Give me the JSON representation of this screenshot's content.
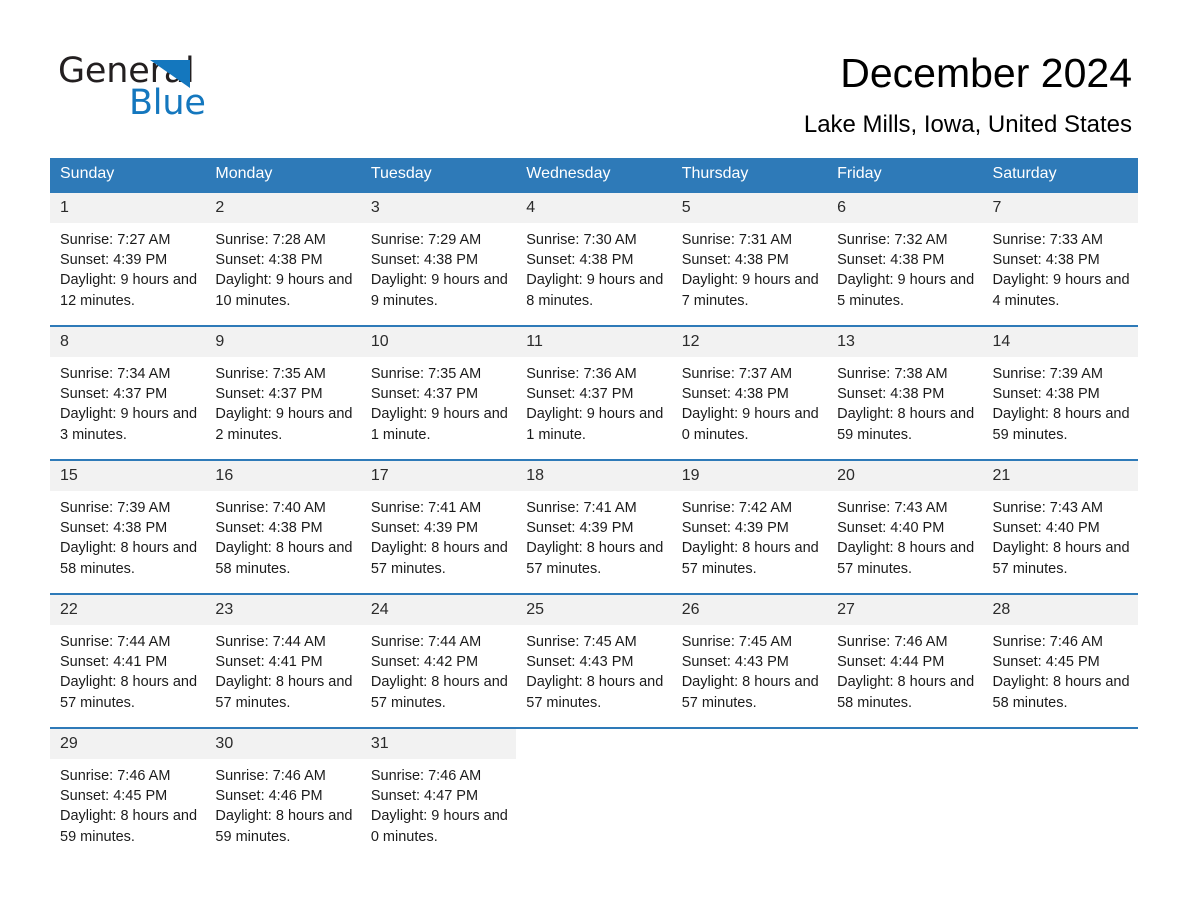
{
  "brand": {
    "word_one": "General",
    "word_two": "Blue",
    "triangle_color": "#1477be",
    "text_color": "#231f20"
  },
  "header": {
    "title": "December 2024",
    "location": "Lake Mills, Iowa, United States",
    "accent_color": "#2e7ab8",
    "daynum_band_color": "#f2f2f2"
  },
  "weekdays": [
    "Sunday",
    "Monday",
    "Tuesday",
    "Wednesday",
    "Thursday",
    "Friday",
    "Saturday"
  ],
  "labels": {
    "sunrise_prefix": "Sunrise: ",
    "sunset_prefix": "Sunset: ",
    "daylight_prefix": "Daylight: "
  },
  "weeks": [
    [
      {
        "day": "1",
        "sunrise": "Sunrise: 7:27 AM",
        "sunset": "Sunset: 4:39 PM",
        "daylight": "Daylight: 9 hours and 12 minutes."
      },
      {
        "day": "2",
        "sunrise": "Sunrise: 7:28 AM",
        "sunset": "Sunset: 4:38 PM",
        "daylight": "Daylight: 9 hours and 10 minutes."
      },
      {
        "day": "3",
        "sunrise": "Sunrise: 7:29 AM",
        "sunset": "Sunset: 4:38 PM",
        "daylight": "Daylight: 9 hours and 9 minutes."
      },
      {
        "day": "4",
        "sunrise": "Sunrise: 7:30 AM",
        "sunset": "Sunset: 4:38 PM",
        "daylight": "Daylight: 9 hours and 8 minutes."
      },
      {
        "day": "5",
        "sunrise": "Sunrise: 7:31 AM",
        "sunset": "Sunset: 4:38 PM",
        "daylight": "Daylight: 9 hours and 7 minutes."
      },
      {
        "day": "6",
        "sunrise": "Sunrise: 7:32 AM",
        "sunset": "Sunset: 4:38 PM",
        "daylight": "Daylight: 9 hours and 5 minutes."
      },
      {
        "day": "7",
        "sunrise": "Sunrise: 7:33 AM",
        "sunset": "Sunset: 4:38 PM",
        "daylight": "Daylight: 9 hours and 4 minutes."
      }
    ],
    [
      {
        "day": "8",
        "sunrise": "Sunrise: 7:34 AM",
        "sunset": "Sunset: 4:37 PM",
        "daylight": "Daylight: 9 hours and 3 minutes."
      },
      {
        "day": "9",
        "sunrise": "Sunrise: 7:35 AM",
        "sunset": "Sunset: 4:37 PM",
        "daylight": "Daylight: 9 hours and 2 minutes."
      },
      {
        "day": "10",
        "sunrise": "Sunrise: 7:35 AM",
        "sunset": "Sunset: 4:37 PM",
        "daylight": "Daylight: 9 hours and 1 minute."
      },
      {
        "day": "11",
        "sunrise": "Sunrise: 7:36 AM",
        "sunset": "Sunset: 4:37 PM",
        "daylight": "Daylight: 9 hours and 1 minute."
      },
      {
        "day": "12",
        "sunrise": "Sunrise: 7:37 AM",
        "sunset": "Sunset: 4:38 PM",
        "daylight": "Daylight: 9 hours and 0 minutes."
      },
      {
        "day": "13",
        "sunrise": "Sunrise: 7:38 AM",
        "sunset": "Sunset: 4:38 PM",
        "daylight": "Daylight: 8 hours and 59 minutes."
      },
      {
        "day": "14",
        "sunrise": "Sunrise: 7:39 AM",
        "sunset": "Sunset: 4:38 PM",
        "daylight": "Daylight: 8 hours and 59 minutes."
      }
    ],
    [
      {
        "day": "15",
        "sunrise": "Sunrise: 7:39 AM",
        "sunset": "Sunset: 4:38 PM",
        "daylight": "Daylight: 8 hours and 58 minutes."
      },
      {
        "day": "16",
        "sunrise": "Sunrise: 7:40 AM",
        "sunset": "Sunset: 4:38 PM",
        "daylight": "Daylight: 8 hours and 58 minutes."
      },
      {
        "day": "17",
        "sunrise": "Sunrise: 7:41 AM",
        "sunset": "Sunset: 4:39 PM",
        "daylight": "Daylight: 8 hours and 57 minutes."
      },
      {
        "day": "18",
        "sunrise": "Sunrise: 7:41 AM",
        "sunset": "Sunset: 4:39 PM",
        "daylight": "Daylight: 8 hours and 57 minutes."
      },
      {
        "day": "19",
        "sunrise": "Sunrise: 7:42 AM",
        "sunset": "Sunset: 4:39 PM",
        "daylight": "Daylight: 8 hours and 57 minutes."
      },
      {
        "day": "20",
        "sunrise": "Sunrise: 7:43 AM",
        "sunset": "Sunset: 4:40 PM",
        "daylight": "Daylight: 8 hours and 57 minutes."
      },
      {
        "day": "21",
        "sunrise": "Sunrise: 7:43 AM",
        "sunset": "Sunset: 4:40 PM",
        "daylight": "Daylight: 8 hours and 57 minutes."
      }
    ],
    [
      {
        "day": "22",
        "sunrise": "Sunrise: 7:44 AM",
        "sunset": "Sunset: 4:41 PM",
        "daylight": "Daylight: 8 hours and 57 minutes."
      },
      {
        "day": "23",
        "sunrise": "Sunrise: 7:44 AM",
        "sunset": "Sunset: 4:41 PM",
        "daylight": "Daylight: 8 hours and 57 minutes."
      },
      {
        "day": "24",
        "sunrise": "Sunrise: 7:44 AM",
        "sunset": "Sunset: 4:42 PM",
        "daylight": "Daylight: 8 hours and 57 minutes."
      },
      {
        "day": "25",
        "sunrise": "Sunrise: 7:45 AM",
        "sunset": "Sunset: 4:43 PM",
        "daylight": "Daylight: 8 hours and 57 minutes."
      },
      {
        "day": "26",
        "sunrise": "Sunrise: 7:45 AM",
        "sunset": "Sunset: 4:43 PM",
        "daylight": "Daylight: 8 hours and 57 minutes."
      },
      {
        "day": "27",
        "sunrise": "Sunrise: 7:46 AM",
        "sunset": "Sunset: 4:44 PM",
        "daylight": "Daylight: 8 hours and 58 minutes."
      },
      {
        "day": "28",
        "sunrise": "Sunrise: 7:46 AM",
        "sunset": "Sunset: 4:45 PM",
        "daylight": "Daylight: 8 hours and 58 minutes."
      }
    ],
    [
      {
        "day": "29",
        "sunrise": "Sunrise: 7:46 AM",
        "sunset": "Sunset: 4:45 PM",
        "daylight": "Daylight: 8 hours and 59 minutes."
      },
      {
        "day": "30",
        "sunrise": "Sunrise: 7:46 AM",
        "sunset": "Sunset: 4:46 PM",
        "daylight": "Daylight: 8 hours and 59 minutes."
      },
      {
        "day": "31",
        "sunrise": "Sunrise: 7:46 AM",
        "sunset": "Sunset: 4:47 PM",
        "daylight": "Daylight: 9 hours and 0 minutes."
      },
      {
        "day": "",
        "sunrise": "",
        "sunset": "",
        "daylight": ""
      },
      {
        "day": "",
        "sunrise": "",
        "sunset": "",
        "daylight": ""
      },
      {
        "day": "",
        "sunrise": "",
        "sunset": "",
        "daylight": ""
      },
      {
        "day": "",
        "sunrise": "",
        "sunset": "",
        "daylight": ""
      }
    ]
  ]
}
